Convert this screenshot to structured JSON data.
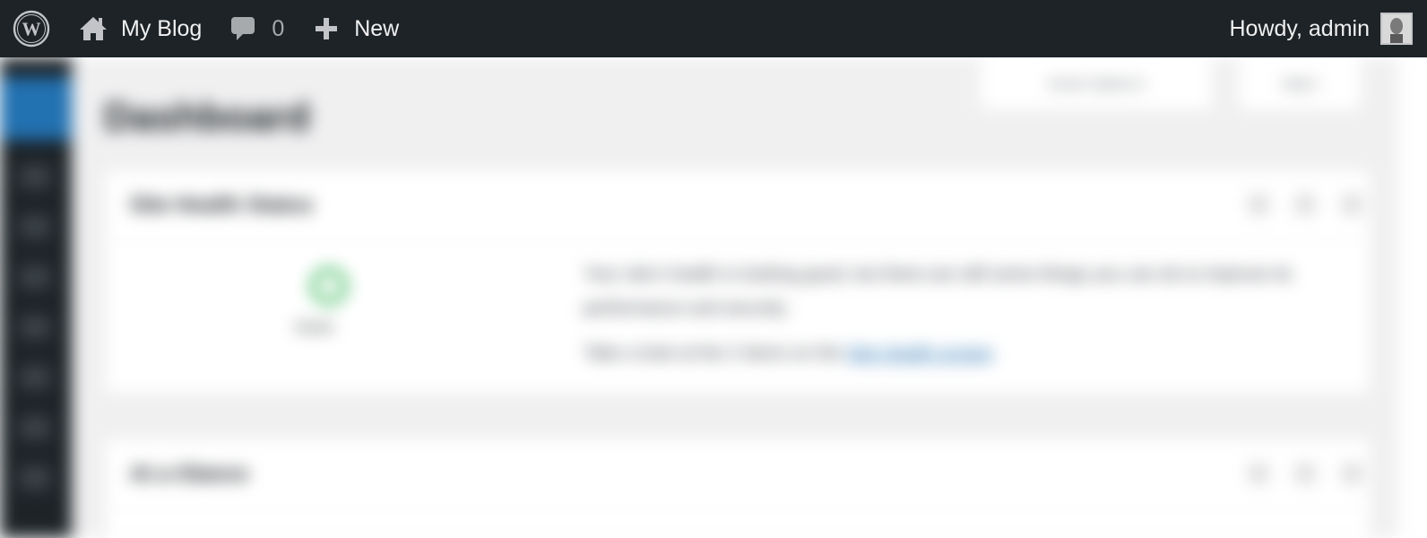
{
  "adminbar": {
    "wp_logo_icon": "wordpress-logo-icon",
    "site_name": "My Blog",
    "site_icon": "home-icon",
    "comments_icon": "comment-bubble-icon",
    "comments_count": "0",
    "new_icon": "plus-icon",
    "new_label": "New",
    "howdy": "Howdy, admin",
    "colors": {
      "bar_bg": "#1d2327",
      "text": "#f0f0f1",
      "muted": "#a7aaad"
    }
  },
  "sidebar": {
    "active_color": "#2271b1",
    "bg": "#1d2327"
  },
  "page": {
    "title": "Dashboard",
    "screen_options": "Screen Options ▾",
    "help": "Help ▾"
  },
  "site_health": {
    "title": "Site Health Status",
    "status": "Good",
    "text": "Your site’s health is looking good, but there are still some things you can do to improve its performance and security.",
    "link_prefix": "Take a look at the 2 items on the",
    "link_text": "Site Health screen",
    "status_color": "#00a32a"
  },
  "at_a_glance": {
    "title": "At a Glance"
  }
}
